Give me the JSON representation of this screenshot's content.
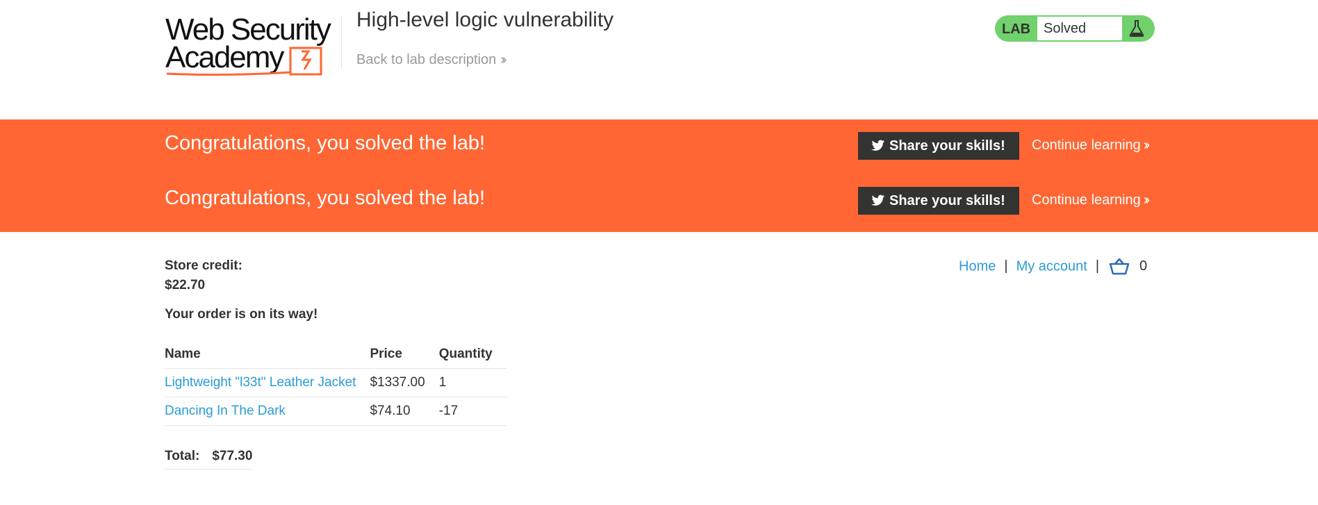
{
  "header": {
    "logo_line1": "Web Security",
    "logo_line2": "Academy",
    "lab_title": "High-level logic vulnerability",
    "back_link": "Back to lab description",
    "lab_badge_label": "LAB",
    "lab_status": "Solved"
  },
  "banner": {
    "rows": [
      {
        "message": "Congratulations, you solved the lab!",
        "share": "Share your skills!",
        "continue": "Continue learning"
      },
      {
        "message": "Congratulations, you solved the lab!",
        "share": "Share your skills!",
        "continue": "Continue learning"
      }
    ]
  },
  "nav": {
    "home": "Home",
    "separator": "|",
    "account": "My account",
    "cart_count": "0"
  },
  "main": {
    "credit_label": "Store credit:",
    "credit_value": "$22.70",
    "order_message": "Your order is on its way!",
    "table": {
      "headers": [
        "Name",
        "Price",
        "Quantity"
      ],
      "rows": [
        {
          "name": "Lightweight \"l33t\" Leather Jacket",
          "price": "$1337.00",
          "quantity": "1"
        },
        {
          "name": "Dancing In The Dark",
          "price": "$74.10",
          "quantity": "-17"
        }
      ]
    },
    "total_label": "Total:",
    "total_value": "$77.30"
  },
  "colors": {
    "accent_orange": "#ff6633",
    "lab_green": "#70d16d",
    "link_blue": "#2a9bd6",
    "dark": "#333332"
  },
  "icons": [
    "chevron-double-right-icon",
    "twitter-icon",
    "flask-icon",
    "shopping-basket-icon"
  ]
}
